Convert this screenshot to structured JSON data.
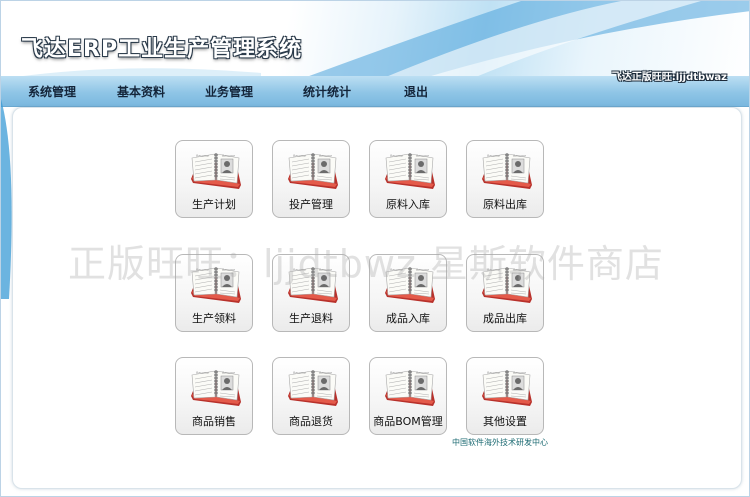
{
  "app": {
    "title": "飞达ERP工业生产管理系统",
    "vendor_label": "飞达正版旺旺:ljjdtbwaz"
  },
  "menu": {
    "items": [
      {
        "label": "系统管理"
      },
      {
        "label": "基本资料"
      },
      {
        "label": "业务管理"
      },
      {
        "label": "统计统计"
      },
      {
        "label": "退出"
      }
    ]
  },
  "modules": [
    {
      "label": "生产计划",
      "icon": "resume-notebook-icon"
    },
    {
      "label": "投产管理",
      "icon": "resume-notebook-icon"
    },
    {
      "label": "原料入库",
      "icon": "resume-notebook-icon"
    },
    {
      "label": "原料出库",
      "icon": "resume-notebook-icon"
    },
    {
      "label": "生产领料",
      "icon": "resume-notebook-icon"
    },
    {
      "label": "生产退料",
      "icon": "resume-notebook-icon"
    },
    {
      "label": "成品入库",
      "icon": "resume-notebook-icon"
    },
    {
      "label": "成品出库",
      "icon": "resume-notebook-icon"
    },
    {
      "label": "商品销售",
      "icon": "resume-notebook-icon"
    },
    {
      "label": "商品退货",
      "icon": "resume-notebook-icon"
    },
    {
      "label": "商品BOM管理",
      "icon": "resume-notebook-icon"
    },
    {
      "label": "其他设置",
      "icon": "resume-notebook-icon"
    }
  ],
  "watermark": "正版旺旺：ljjdtbwz 星斯软件商店",
  "footer": {
    "credit": "中国软件海外技术研发中心"
  },
  "colors": {
    "menubar": "#8fc5e6",
    "accent_blue": "#3a9bd6",
    "notebook_cover": "#c8342c",
    "footer_text": "#1d6b73"
  }
}
